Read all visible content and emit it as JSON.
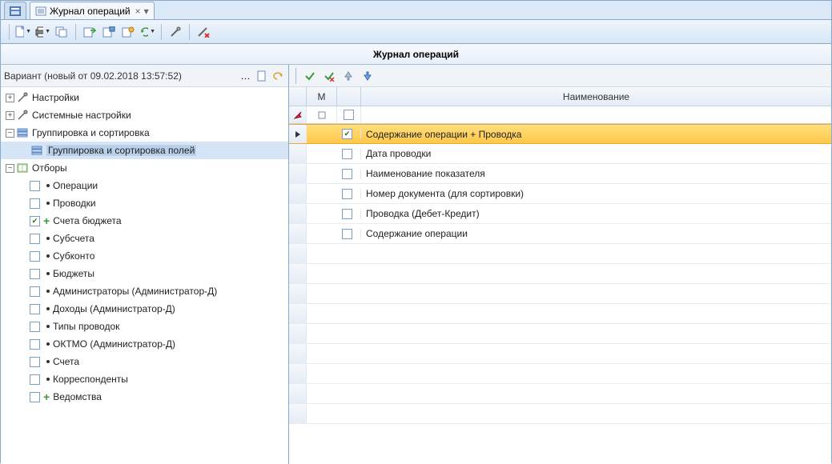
{
  "tabs": {
    "main": "Журнал операций"
  },
  "title": "Журнал операций",
  "variant": "Вариант (новый от 09.02.2018 13:57:52)",
  "tree": {
    "settings": "Настройки",
    "sys_settings": "Системные настройки",
    "group_sort": "Группировка и сортировка",
    "group_sort_fields": "Группировка и сортировка полей",
    "filters": "Отборы",
    "f_ops": "Операции",
    "f_ent": "Проводки",
    "f_acc": "Счета бюджета",
    "f_sub": "Субсчета",
    "f_subk": "Субконто",
    "f_bud": "Бюджеты",
    "f_admin": "Администраторы (Администратор-Д)",
    "f_inc": "Доходы (Администратор-Д)",
    "f_types": "Типы проводок",
    "f_oktmo": "ОКТМО (Администратор-Д)",
    "f_accounts": "Счета",
    "f_corr": "Корреспонденты",
    "f_ved": "Ведомства"
  },
  "grid": {
    "col_m": "М",
    "col_name": "Наименование",
    "rows": {
      "r0": "Содержание операции + Проводка",
      "r1": "Дата проводки",
      "r2": "Наименование показателя",
      "r3": "Номер документа (для сортировки)",
      "r4": "Проводка (Дебет-Кредит)",
      "r5": "Содержание операции"
    }
  }
}
